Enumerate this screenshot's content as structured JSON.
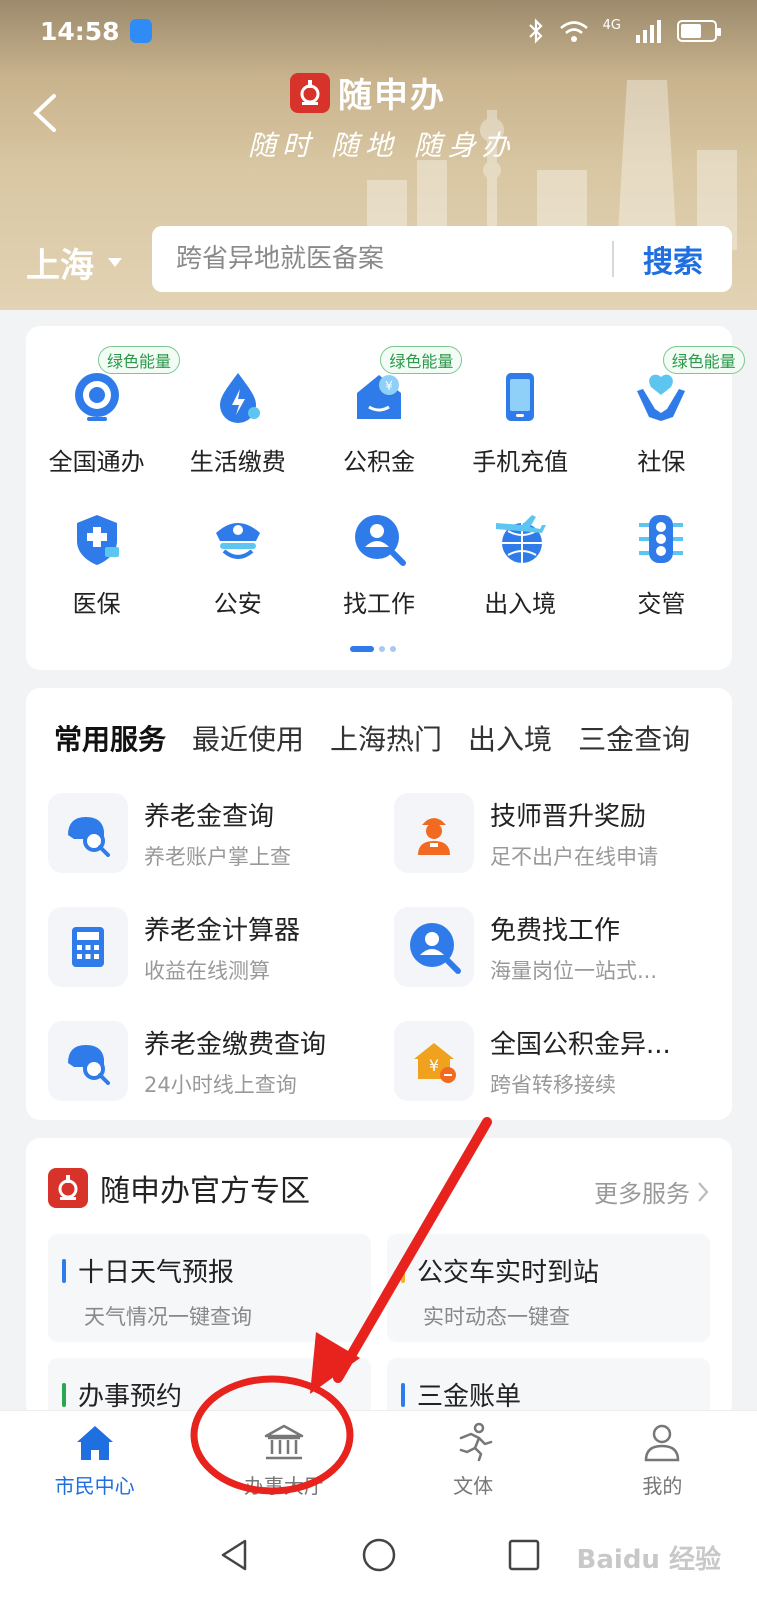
{
  "status": {
    "time": "14:58",
    "network": "4G"
  },
  "header": {
    "brand_name": "随申办",
    "slogan": "随时 随地 随身办",
    "city": "上海",
    "search": {
      "placeholder": "跨省异地就医备案",
      "button": "搜索"
    }
  },
  "grid": {
    "items": [
      {
        "label": "全国通办",
        "icon": "globe-service-icon",
        "tag": "绿色能量"
      },
      {
        "label": "生活缴费",
        "icon": "utility-drop-icon",
        "tag": ""
      },
      {
        "label": "公积金",
        "icon": "housing-fund-icon",
        "tag": "绿色能量"
      },
      {
        "label": "手机充值",
        "icon": "phone-icon",
        "tag": ""
      },
      {
        "label": "社保",
        "icon": "social-security-hands-icon",
        "tag": "绿色能量"
      },
      {
        "label": "医保",
        "icon": "medical-shield-icon",
        "tag": ""
      },
      {
        "label": "公安",
        "icon": "police-cap-icon",
        "tag": ""
      },
      {
        "label": "找工作",
        "icon": "job-search-icon",
        "tag": ""
      },
      {
        "label": "出入境",
        "icon": "airplane-globe-icon",
        "tag": ""
      },
      {
        "label": "交管",
        "icon": "traffic-light-icon",
        "tag": ""
      }
    ]
  },
  "services": {
    "tabs": [
      "常用服务",
      "最近使用",
      "上海热门",
      "出入境",
      "三金查询"
    ],
    "items": [
      {
        "title": "养老金查询",
        "sub": "养老账户掌上查",
        "icon": "pension-search-icon"
      },
      {
        "title": "技师晋升奖励",
        "sub": "足不出户在线申请",
        "icon": "technician-icon"
      },
      {
        "title": "养老金计算器",
        "sub": "收益在线测算",
        "icon": "calculator-icon"
      },
      {
        "title": "免费找工作",
        "sub": "海量岗位一站式...",
        "icon": "job-search-icon"
      },
      {
        "title": "养老金缴费查询",
        "sub": "24小时线上查询",
        "icon": "pension-search-icon"
      },
      {
        "title": "全国公积金异...",
        "sub": "跨省转移接续",
        "icon": "housing-transfer-icon"
      }
    ]
  },
  "official": {
    "title": "随申办官方专区",
    "more": "更多服务",
    "items": [
      {
        "title": "十日天气预报",
        "sub": "天气情况一键查询",
        "color": "#2f7bea"
      },
      {
        "title": "公交车实时到站",
        "sub": "实时动态一键查",
        "color": "#f0b429"
      },
      {
        "title": "办事预约",
        "sub": "",
        "color": "#2aa84f"
      },
      {
        "title": "三金账单",
        "sub": "",
        "color": "#2f7bea"
      }
    ]
  },
  "bottom_nav": [
    {
      "label": "市民中心",
      "icon": "home-icon",
      "active": true
    },
    {
      "label": "办事大厅",
      "icon": "government-hall-icon",
      "active": false
    },
    {
      "label": "文体",
      "icon": "running-person-icon",
      "active": false
    },
    {
      "label": "我的",
      "icon": "user-icon",
      "active": false
    }
  ],
  "watermark": "Baidu 经验",
  "colors": {
    "accent": "#1f6fe0",
    "annotation": "#e8231d",
    "brand_red": "#d8332b"
  }
}
